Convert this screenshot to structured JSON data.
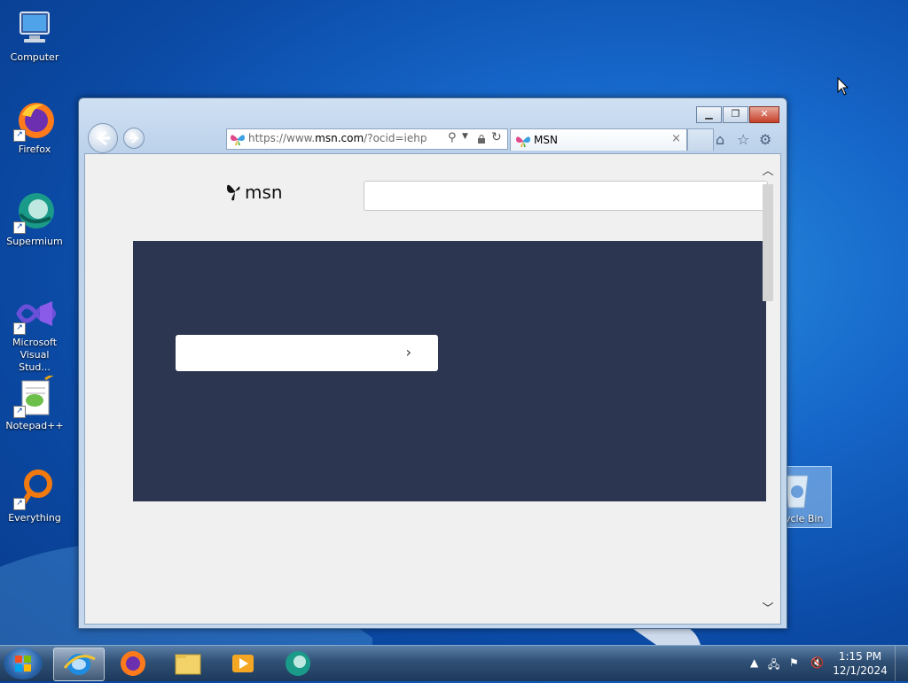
{
  "desktop": {
    "icons": [
      {
        "label": "Computer"
      },
      {
        "label": "Firefox"
      },
      {
        "label": "Supermium"
      },
      {
        "label": "Microsoft Visual Stud..."
      },
      {
        "label": "Notepad++"
      },
      {
        "label": "Everything"
      }
    ],
    "recycle_bin_label": "ycle Bin"
  },
  "browser": {
    "address": {
      "prefix": "https://www.",
      "domain": "msn.com",
      "path": "/?ocid=iehp"
    },
    "tab": {
      "title": "MSN",
      "close": "×"
    },
    "logo_text": "msn",
    "hero_chevron": "›"
  },
  "taskbar": {
    "time": "1:15 PM",
    "date": "12/1/2024"
  },
  "colors": {
    "hero_bg": "#2c3650",
    "taskbar": "#2f4f74"
  }
}
